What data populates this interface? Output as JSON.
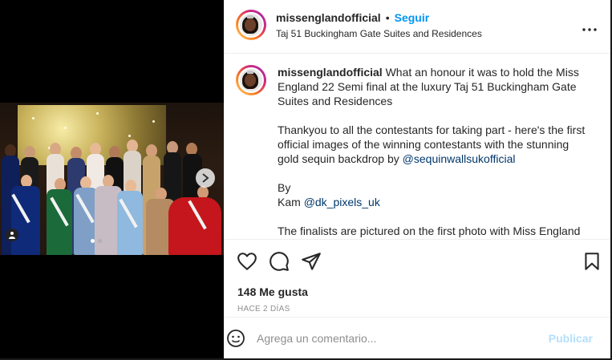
{
  "post": {
    "header": {
      "username": "missenglandofficial",
      "separator": "•",
      "follow_label": "Seguir",
      "location": "Taj 51 Buckingham Gate Suites and Residences",
      "more_icon": "more-horizontal-icon"
    },
    "caption": {
      "username": "missenglandofficial",
      "line1_text": "What an honour it was to hold the Miss England 22 Semi final at the luxury Taj 51 Buckingham Gate Suites and Residences",
      "para2_text": "Thankyou to all the contestants for taking part - here's the first official images of the winning contestants with the stunning gold sequin backdrop by ",
      "para2_mention": "@sequinwallsukofficial",
      "para3_by": "By",
      "para3_name": "Kam ",
      "para3_mention": "@dk_pixels_uk",
      "para4_text": "The finalists are pictured on the first photo with Miss England"
    },
    "media": {
      "carousel_dots": 2,
      "active_dot": 0,
      "next_icon": "chevron-right-icon",
      "tag_icon": "user-tag-icon"
    },
    "actions": {
      "like_icon": "heart-icon",
      "comment_icon": "comment-icon",
      "share_icon": "send-icon",
      "save_icon": "bookmark-icon"
    },
    "likes_text": "148 Me gusta",
    "time_text": "HACE 2 DÍAS",
    "comment": {
      "emoji_icon": "emoji-icon",
      "placeholder": "Agrega un comentario...",
      "publish_label": "Publicar"
    },
    "colors": {
      "accent": "#0095f6",
      "mention": "#00376b",
      "publish_disabled": "#b3dffc",
      "muted": "#8e8e8e"
    }
  }
}
